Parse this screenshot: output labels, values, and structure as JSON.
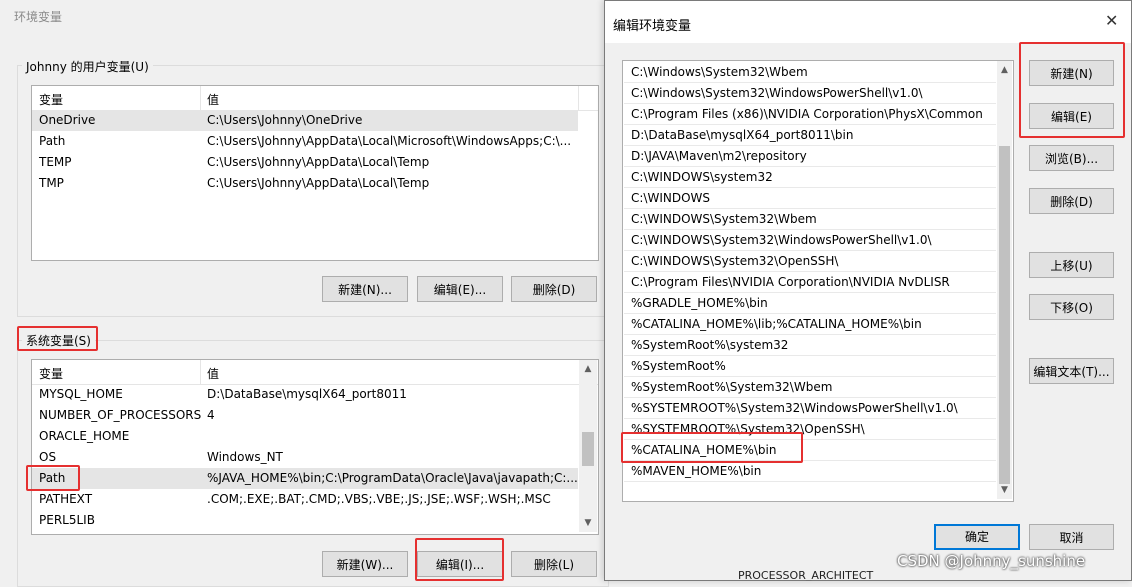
{
  "bg_dialog": {
    "title": "环境变量",
    "user_group_label": "Johnny 的用户变量(U)",
    "user_table": {
      "headers": [
        "变量",
        "值"
      ],
      "rows": [
        {
          "name": "OneDrive",
          "value": "C:\\Users\\Johnny\\OneDrive"
        },
        {
          "name": "Path",
          "value": "C:\\Users\\Johnny\\AppData\\Local\\Microsoft\\WindowsApps;C:\\..."
        },
        {
          "name": "TEMP",
          "value": "C:\\Users\\Johnny\\AppData\\Local\\Temp"
        },
        {
          "name": "TMP",
          "value": "C:\\Users\\Johnny\\AppData\\Local\\Temp"
        }
      ]
    },
    "user_buttons": {
      "new": "新建(N)...",
      "edit": "编辑(E)...",
      "delete": "删除(D)"
    },
    "system_group_label": "系统变量(S)",
    "system_table": {
      "headers": [
        "变量",
        "值"
      ],
      "rows": [
        {
          "name": "MYSQL_HOME",
          "value": "D:\\DataBase\\mysqlX64_port8011"
        },
        {
          "name": "NUMBER_OF_PROCESSORS",
          "value": "4"
        },
        {
          "name": "ORACLE_HOME",
          "value": ""
        },
        {
          "name": "OS",
          "value": "Windows_NT"
        },
        {
          "name": "Path",
          "value": "%JAVA_HOME%\\bin;C:\\ProgramData\\Oracle\\Java\\javapath;C:..."
        },
        {
          "name": "PATHEXT",
          "value": ".COM;.EXE;.BAT;.CMD;.VBS;.VBE;.JS;.JSE;.WSF;.WSH;.MSC"
        },
        {
          "name": "PERL5LIB",
          "value": ""
        }
      ]
    },
    "system_buttons": {
      "new": "新建(W)...",
      "edit": "编辑(I)...",
      "delete": "删除(L)"
    },
    "partial_behind_text": "PROCESSOR_ARCHITECT"
  },
  "edit_dialog": {
    "title": "编辑环境变量",
    "close_icon": "close-icon",
    "paths": [
      "C:\\Windows\\System32\\Wbem",
      "C:\\Windows\\System32\\WindowsPowerShell\\v1.0\\",
      "C:\\Program Files (x86)\\NVIDIA Corporation\\PhysX\\Common",
      "D:\\DataBase\\mysqlX64_port8011\\bin",
      "D:\\JAVA\\Maven\\m2\\repository",
      "C:\\WINDOWS\\system32",
      "C:\\WINDOWS",
      "C:\\WINDOWS\\System32\\Wbem",
      "C:\\WINDOWS\\System32\\WindowsPowerShell\\v1.0\\",
      "C:\\WINDOWS\\System32\\OpenSSH\\",
      "C:\\Program Files\\NVIDIA Corporation\\NVIDIA NvDLISR",
      "%GRADLE_HOME%\\bin",
      "%CATALINA_HOME%\\lib;%CATALINA_HOME%\\bin",
      "%SystemRoot%\\system32",
      "%SystemRoot%",
      "%SystemRoot%\\System32\\Wbem",
      "%SYSTEMROOT%\\System32\\WindowsPowerShell\\v1.0\\",
      "%SYSTEMROOT%\\System32\\OpenSSH\\",
      "%CATALINA_HOME%\\bin",
      "%MAVEN_HOME%\\bin"
    ],
    "buttons": {
      "new": "新建(N)",
      "edit": "编辑(E)",
      "browse": "浏览(B)...",
      "delete": "删除(D)",
      "move_up": "上移(U)",
      "move_down": "下移(O)",
      "edit_text": "编辑文本(T)..."
    },
    "ok": "确定",
    "cancel": "取消"
  },
  "watermark": "CSDN @Johnny_sunshine"
}
